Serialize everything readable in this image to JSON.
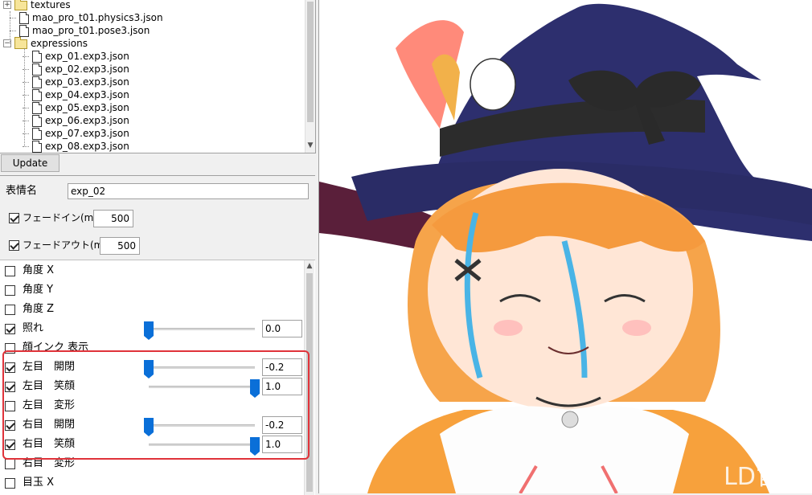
{
  "tree": {
    "items": [
      {
        "label": "textures",
        "kind": "folder"
      },
      {
        "label": "mao_pro_t01.physics3.json",
        "kind": "file"
      },
      {
        "label": "mao_pro_t01.pose3.json",
        "kind": "file"
      },
      {
        "label": "expressions",
        "kind": "folder"
      },
      {
        "label": "exp_01.exp3.json",
        "kind": "file"
      },
      {
        "label": "exp_02.exp3.json",
        "kind": "file"
      },
      {
        "label": "exp_03.exp3.json",
        "kind": "file"
      },
      {
        "label": "exp_04.exp3.json",
        "kind": "file"
      },
      {
        "label": "exp_05.exp3.json",
        "kind": "file"
      },
      {
        "label": "exp_06.exp3.json",
        "kind": "file"
      },
      {
        "label": "exp_07.exp3.json",
        "kind": "file"
      },
      {
        "label": "exp_08.exp3.json",
        "kind": "file"
      }
    ],
    "expand_plus": "+",
    "expand_minus": "−"
  },
  "update_button": "Update",
  "form": {
    "name_label": "表情名",
    "name_value": "exp_02",
    "fadein_label": "フェードイン(ms)",
    "fadein_checked": true,
    "fadein_value": "500",
    "fadeout_label": "フェードアウト(ms)",
    "fadeout_checked": true,
    "fadeout_value": "500"
  },
  "params": [
    {
      "name": "角度 X",
      "checked": false
    },
    {
      "name": "角度 Y",
      "checked": false
    },
    {
      "name": "角度 Z",
      "checked": false
    },
    {
      "name": "照れ",
      "checked": true,
      "slider": 0.0,
      "value": "0.0"
    },
    {
      "name": "顔インク 表示",
      "checked": false
    },
    {
      "name": "左目　開閉",
      "checked": true,
      "slider": 0.0,
      "value": "-0.2"
    },
    {
      "name": "左目　笑顔",
      "checked": true,
      "slider": 1.0,
      "value": "1.0"
    },
    {
      "name": "左目　変形",
      "checked": false
    },
    {
      "name": "右目　開閉",
      "checked": true,
      "slider": 0.0,
      "value": "-0.2"
    },
    {
      "name": "右目　笑顔",
      "checked": true,
      "slider": 1.0,
      "value": "1.0"
    },
    {
      "name": "右目　変形",
      "checked": false
    },
    {
      "name": "目玉 X",
      "checked": false
    }
  ],
  "watermark": "LD官方",
  "colors": {
    "accent_thumb": "#0a6fd8",
    "highlight_box": "#e0333a",
    "hat": "#2d2f6e",
    "hair": "#f6a44a"
  }
}
